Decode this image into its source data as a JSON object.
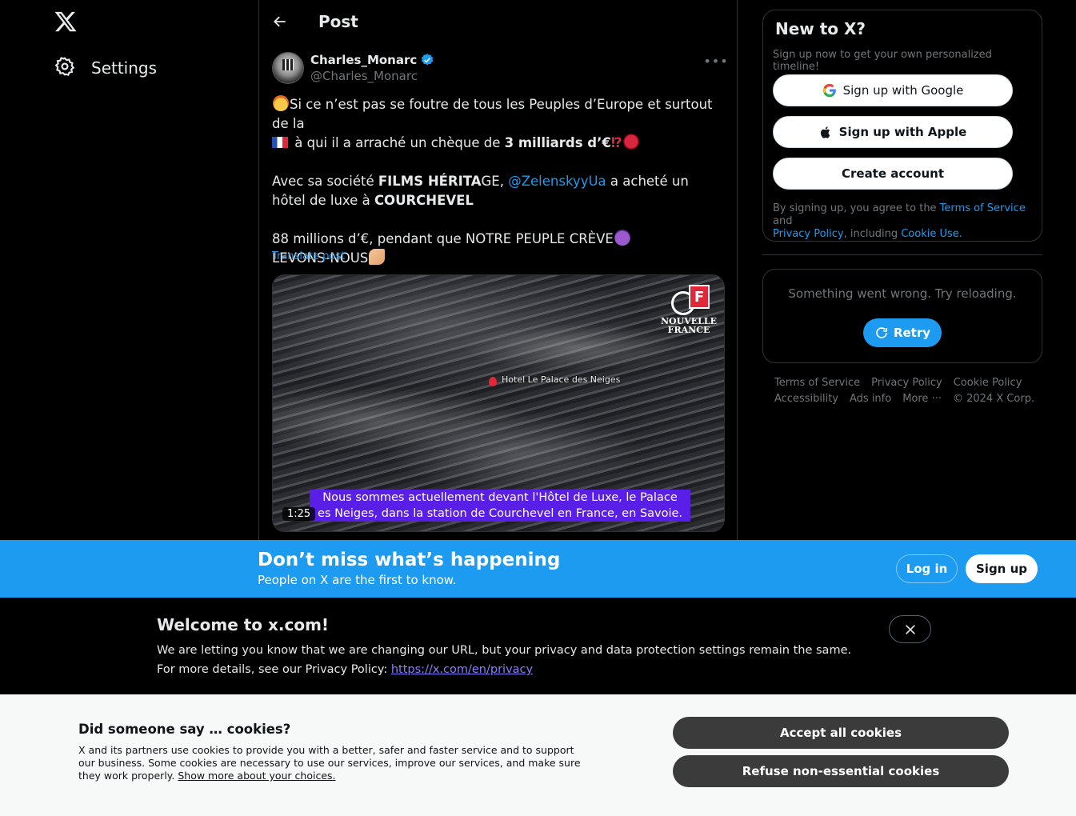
{
  "nav": {
    "settings_label": "Settings",
    "logo_icon": "x-logo-icon",
    "settings_icon": "gear-icon"
  },
  "post_header": {
    "title": "Post",
    "back_icon": "arrow-left-icon"
  },
  "author": {
    "name": "Charles_Monarc",
    "handle": "@Charles_Monarc",
    "verified": true
  },
  "tweet": {
    "line1": "Si ce n’est pas se foutre de tous les Peuples d’Europe et surtout de la",
    "line2_pre": " à qui il a arraché un chèque de ",
    "line2_bold": "3 milliards d’€",
    "line2_marks": "⁉",
    "p2_a": "Avec sa société ",
    "p2_bold1": "FILMS HÉRITA",
    "p2_b": "GE, ",
    "p2_mention": "@ZelenskyyUa",
    "p2_c": " a acheté un hôtel de luxe à ",
    "p2_bold2": "COURCHEVEL",
    "p3_a": "88 millions d’€, pendant que NOTRE PEUPLE CRÈVE",
    "p3_b": "LEVONS-NOUS",
    "translate": "Translate post"
  },
  "video": {
    "duration": "1:25",
    "map_label": "Hotel Le Palace des Neiges",
    "subtitle_1": "Nous sommes actuellement devant l'Hôtel de Luxe, le Palace",
    "subtitle_2": "es Neiges, dans la station de Courchevel en France, en Savoie.",
    "logo_letter": "F",
    "logo_text_1": "NOUVELLE",
    "logo_text_2": "FRANCE"
  },
  "signup_card": {
    "title": "New to X?",
    "subtitle": "Sign up now to get your own personalized timeline!",
    "google": "Sign up with Google",
    "apple": "Sign up with Apple",
    "create": "Create account",
    "terms_pre": "By signing up, you agree to the ",
    "terms_link": "Terms of Service",
    "terms_and": " and",
    "privacy_link": "Privacy Policy",
    "including": ", including ",
    "cookie_link": "Cookie Use."
  },
  "error_card": {
    "message": "Something went wrong. Try reloading.",
    "retry": "Retry"
  },
  "footer": {
    "links": [
      "Terms of Service",
      "Privacy Policy",
      "Cookie Policy",
      "Accessibility",
      "Ads info",
      "More ···"
    ],
    "copyright": "© 2024 X Corp."
  },
  "banner": {
    "title": "Don’t miss what’s happening",
    "subtitle": "People on X are the first to know.",
    "login": "Log in",
    "signup": "Sign up"
  },
  "welcome": {
    "title": "Welcome to x.com!",
    "line1": "We are letting you know that we are changing our URL, but your privacy and data protection settings remain the same.",
    "line2_pre": "For more details, see our Privacy Policy: ",
    "line2_link": "https://x.com/en/privacy"
  },
  "cookies": {
    "title": "Did someone say … cookies?",
    "desc": "X and its partners use cookies to provide you with a better, safer and faster service and to support our business. Some cookies are necessary to use our services, improve our services, and make sure they work properly. ",
    "desc_link": "Show more about your choices.",
    "accept": "Accept all cookies",
    "refuse": "Refuse non-essential cookies"
  },
  "colors": {
    "accent": "#1d9bf0",
    "background": "#000000",
    "cookie_bg": "#f7f9f9"
  }
}
